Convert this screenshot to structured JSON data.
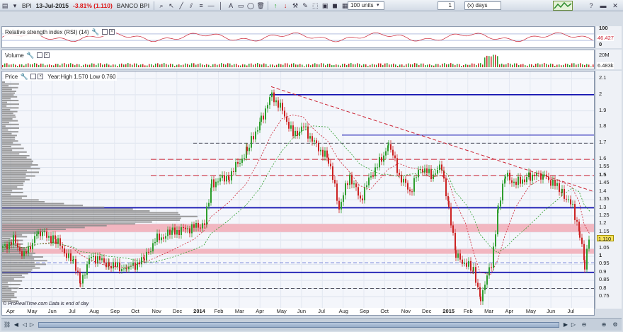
{
  "toolbar": {
    "symbol": "BPI",
    "date": "13-Jul-2015",
    "change": "-3.81% (1.110)",
    "name": "BANCO BPI",
    "units": "100 units",
    "period_value": "1",
    "period_unit": "(x) days"
  },
  "rsi_panel": {
    "title": "Relative strength index (RSI) (14)",
    "ticks": [
      "100",
      "50",
      "0"
    ],
    "current": "46.427"
  },
  "volume_panel": {
    "title": "Volume",
    "ticks": [
      "20M"
    ],
    "current": "6.483k"
  },
  "price_panel": {
    "title": "Price",
    "info": "Year:High 1.570 Low 0.760",
    "ticks": [
      "2.1",
      "2",
      "1.9",
      "1.8",
      "1.7",
      "1.6",
      "1.55",
      "1.5",
      "1.45",
      "1.4",
      "1.35",
      "1.3",
      "1.25",
      "1.2",
      "1.15",
      "1.1",
      "1.05",
      "1",
      "0.95",
      "0.9",
      "0.85",
      "0.8",
      "0.75"
    ],
    "bold_ticks": [
      "1.5",
      "1"
    ],
    "current": "1.110"
  },
  "xaxis": {
    "labels": [
      "Apr",
      "May",
      "Jun",
      "Jul",
      "Aug",
      "Sep",
      "Oct",
      "Nov",
      "Dec",
      "2014",
      "Feb",
      "Mar",
      "Apr",
      "May",
      "Jun",
      "Jul",
      "Aug",
      "Sep",
      "Oct",
      "Nov",
      "Dec",
      "2015",
      "Feb",
      "Mar",
      "Apr",
      "May",
      "Jun",
      "Jul"
    ]
  },
  "copyright": "© ProRealTime.com  Data is end of day",
  "colors": {
    "up": "#2e9e2e",
    "down": "#cc2222",
    "support": "#1010b0",
    "zone": "#f2b6c0"
  }
}
